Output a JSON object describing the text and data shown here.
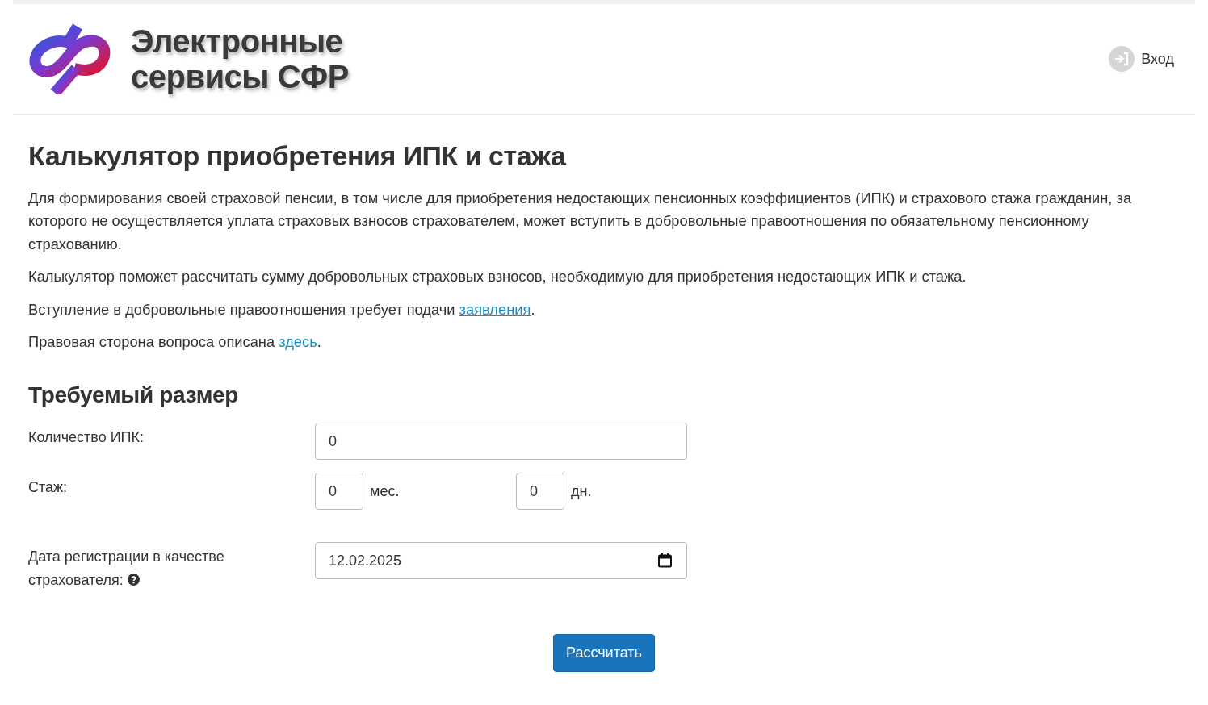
{
  "header": {
    "logo_lines": [
      "Электронные",
      "сервисы СФР"
    ],
    "login_link": "Вход"
  },
  "page": {
    "title": "Калькулятор приобретения ИПК и стажа",
    "paragraphs": [
      {
        "text": "Для формирования своей страховой пенсии, в том числе для приобретения недостающих пенсионных коэффициентов (ИПК) и страхового стажа гражданин, за которого не осуществляется уплата страховых взносов страхователем, может вступить в добровольные правоотношения по обязательному пенсионному страхованию."
      },
      {
        "text": "Калькулятор поможет рассчитать сумму добровольных страховых взносов, необходимую для приобретения недостающих ИПК и стажа."
      },
      {
        "text": "Вступление в добровольные правоотношения требует подачи ",
        "link": "заявления",
        "text_after": "."
      },
      {
        "text": "Правовая сторона вопроса описана ",
        "link": "здесь",
        "text_after": "."
      }
    ]
  },
  "section": {
    "title": "Требуемый размер"
  },
  "form": {
    "ipk": {
      "label": "Количество ИПК:",
      "value": "0"
    },
    "stazh": {
      "label": "Стаж:",
      "months": {
        "value": "0",
        "unit": "мес."
      },
      "days": {
        "value": "0",
        "unit": "дн."
      }
    },
    "date": {
      "label_lines": [
        "Дата регистрации в качестве",
        "страхователя:"
      ],
      "value": "12.02.2025"
    }
  },
  "submit": "Рассчитать"
}
